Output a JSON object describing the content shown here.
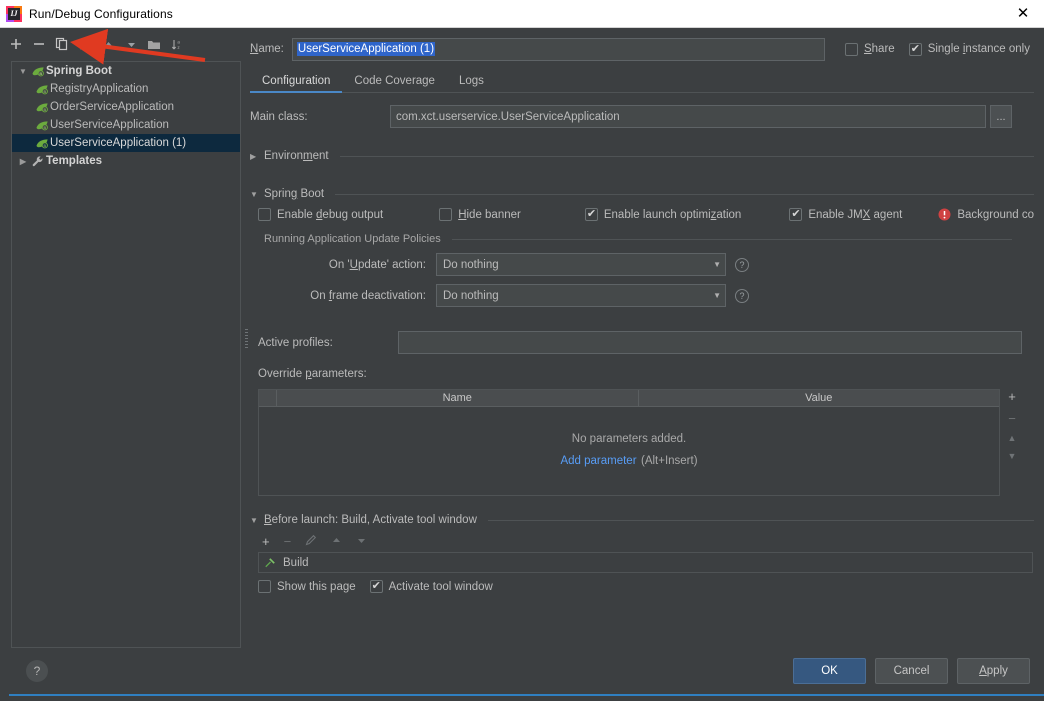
{
  "window": {
    "title": "Run/Debug Configurations",
    "app_icon": "intellij-idea-icon",
    "close_label": "✕"
  },
  "tree_toolbar": {
    "add": "+",
    "remove": "−",
    "copy": "copy-icon",
    "save": "save-icon",
    "move_up": "move-up-icon",
    "move_down": "move-down-icon",
    "folder": "new-folder-icon",
    "sort": "sort-icon"
  },
  "tree": {
    "nodes": [
      {
        "label": "Spring Boot",
        "type": "group",
        "expanded": true,
        "icon": "spring-boot-icon",
        "selected": false
      },
      {
        "label": "RegistryApplication",
        "type": "leaf",
        "icon": "spring-boot-icon",
        "selected": false
      },
      {
        "label": "OrderServiceApplication",
        "type": "leaf",
        "icon": "spring-boot-icon",
        "selected": false
      },
      {
        "label": "UserServiceApplication",
        "type": "leaf",
        "icon": "spring-boot-icon",
        "selected": false
      },
      {
        "label": "UserServiceApplication (1)",
        "type": "leaf",
        "icon": "spring-boot-icon",
        "selected": true
      },
      {
        "label": "Templates",
        "type": "group",
        "expanded": false,
        "icon": "wrench-icon",
        "selected": false
      }
    ]
  },
  "name_row": {
    "label": "Name:",
    "value": "UserServiceApplication (1)",
    "share_label": "Share",
    "share_checked": false,
    "single_instance_label": "Single instance only",
    "single_instance_checked": true
  },
  "tabs": [
    {
      "label": "Configuration",
      "active": true
    },
    {
      "label": "Code Coverage",
      "active": false
    },
    {
      "label": "Logs",
      "active": false
    }
  ],
  "configuration": {
    "main_class_label": "Main class:",
    "main_class_value": "com.xct.userservice.UserServiceApplication",
    "browse_button": "...",
    "environment_section": "Environment",
    "spring_boot_section": "Spring Boot",
    "checkboxes": [
      {
        "label": "Enable debug output",
        "checked": false
      },
      {
        "label": "Hide banner",
        "checked": false
      },
      {
        "label": "Enable launch optimization",
        "checked": true
      },
      {
        "label": "Enable JMX agent",
        "checked": true
      }
    ],
    "warning": {
      "icon": "error-circle-icon",
      "text": "Background compilation enabled",
      "color": "#cf4242"
    },
    "update_policies_section": "Running Application Update Policies",
    "on_update_label": "On 'Update' action:",
    "on_update_value": "Do nothing",
    "on_frame_label": "On frame deactivation:",
    "on_frame_value": "Do nothing",
    "help_icon": "?",
    "active_profiles_label": "Active profiles:",
    "active_profiles_value": "",
    "override_params_label": "Override parameters:",
    "params_table": {
      "columns": [
        "Name",
        "Value"
      ],
      "rows": [],
      "empty_message": "No parameters added.",
      "add_link": "Add parameter",
      "add_hint": "(Alt+Insert)"
    },
    "params_side_buttons": [
      "+",
      "−",
      "▲",
      "▼"
    ]
  },
  "before_launch": {
    "section_title": "Before launch: Build, Activate tool window",
    "toolbar": [
      "+",
      "−",
      "edit-icon",
      "move-up-icon",
      "move-down-icon"
    ],
    "tasks": [
      {
        "label": "Build",
        "icon": "build-hammer-icon"
      }
    ],
    "show_page_label": "Show this page",
    "show_page_checked": false,
    "activate_window_label": "Activate tool window",
    "activate_window_checked": true
  },
  "footer": {
    "help": "?",
    "ok": "OK",
    "cancel": "Cancel",
    "apply": "Apply"
  },
  "colors": {
    "accent": "#365880",
    "link": "#589df6",
    "selection": "#2f65ca",
    "tree_selection": "#0d293e",
    "error": "#cf4242",
    "tab_underline": "#4a88c7",
    "annotation_arrow": "#e03a21"
  }
}
